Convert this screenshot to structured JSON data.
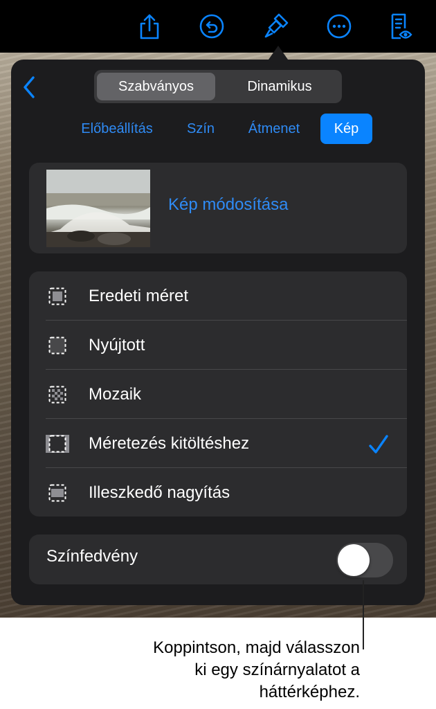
{
  "toolbar": {
    "icons": [
      "share-icon",
      "undo-icon",
      "paintbrush-icon",
      "more-icon",
      "reader-view-icon"
    ]
  },
  "segmented": {
    "options": [
      "Szabványos",
      "Dinamikus"
    ],
    "selected": "Szabványos"
  },
  "tabs": [
    {
      "label": "Előbeállítás"
    },
    {
      "label": "Szín"
    },
    {
      "label": "Átmenet"
    },
    {
      "label": "Kép"
    }
  ],
  "selected_tab": "Kép",
  "image_card": {
    "change_label": "Kép módosítása"
  },
  "scale_options": [
    {
      "label": "Eredeti méret",
      "icon": "original-size-icon"
    },
    {
      "label": "Nyújtott",
      "icon": "stretch-icon"
    },
    {
      "label": "Mozaik",
      "icon": "tile-icon"
    },
    {
      "label": "Méretezés kitöltéshez",
      "icon": "scale-to-fill-icon"
    },
    {
      "label": "Illeszkedő nagyítás",
      "icon": "scale-to-fit-icon"
    }
  ],
  "selected_option": "Méretezés kitöltéshez",
  "color_overlay": {
    "label": "Színfedvény",
    "enabled": false
  },
  "callout": {
    "line1": "Koppintson, majd válasszon",
    "line2": "ki egy színárnyalatot a",
    "line3": "háttérképhez."
  },
  "colors": {
    "accent": "#0a84ff",
    "popover": "#1c1c1e",
    "card": "#2c2c2e"
  }
}
